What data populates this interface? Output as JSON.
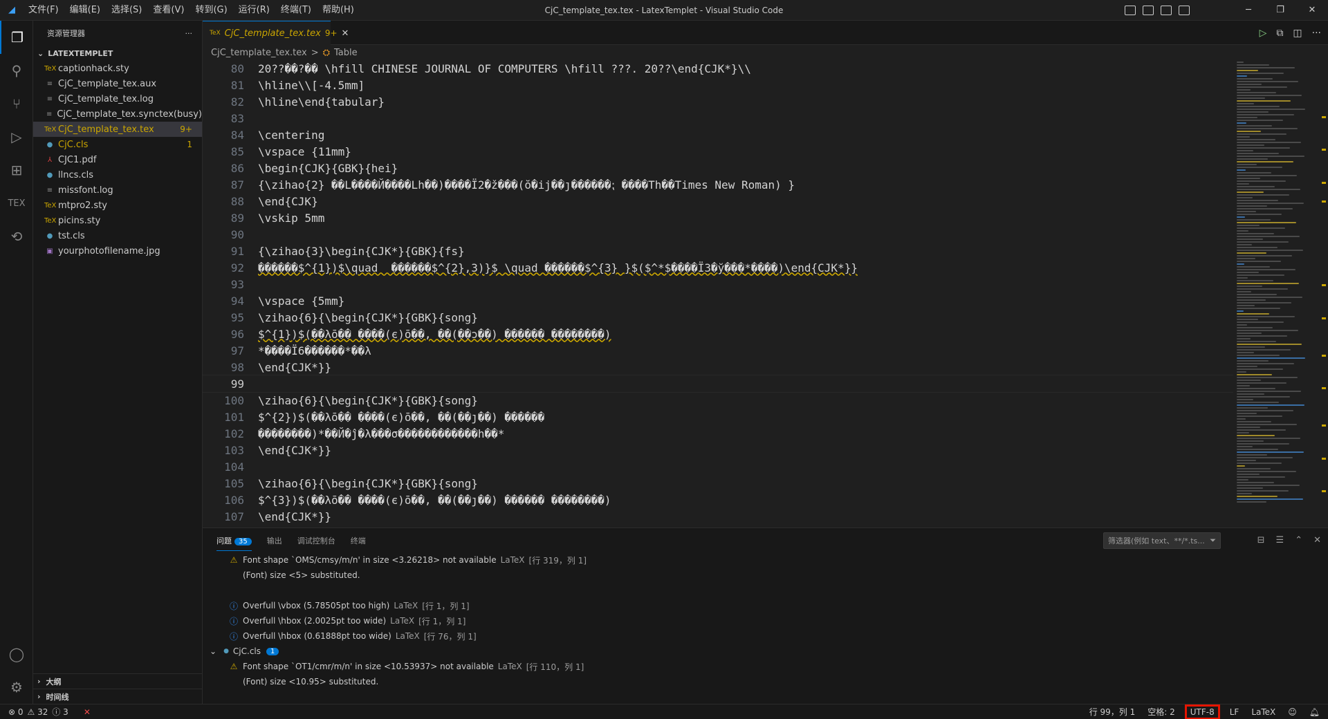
{
  "titlebar": {
    "logo": "◢",
    "menus": [
      "文件(F)",
      "编辑(E)",
      "选择(S)",
      "查看(V)",
      "转到(G)",
      "运行(R)",
      "终端(T)",
      "帮助(H)"
    ],
    "title": "CjC_template_tex.tex - LatexTemplet - Visual Studio Code",
    "minimize": "─",
    "restore": "❐",
    "close": "✕"
  },
  "sidebar": {
    "title": "资源管理器",
    "more": "···",
    "folder": "LATEXTEMPLET",
    "files": [
      {
        "name": "captionhack.sty",
        "icon": "TeX",
        "badge": ""
      },
      {
        "name": "CjC_template_tex.aux",
        "icon": "≡",
        "badge": ""
      },
      {
        "name": "CjC_template_tex.log",
        "icon": "≡",
        "badge": ""
      },
      {
        "name": "CjC_template_tex.synctex(busy)",
        "icon": "≡",
        "badge": ""
      },
      {
        "name": "CjC_template_tex.tex",
        "icon": "TeX",
        "badge": "9+"
      },
      {
        "name": "CjC.cls",
        "icon": "●",
        "badge": "1"
      },
      {
        "name": "CJC1.pdf",
        "icon": "⅄",
        "badge": ""
      },
      {
        "name": "llncs.cls",
        "icon": "●",
        "badge": ""
      },
      {
        "name": "missfont.log",
        "icon": "≡",
        "badge": ""
      },
      {
        "name": "mtpro2.sty",
        "icon": "TeX",
        "badge": ""
      },
      {
        "name": "picins.sty",
        "icon": "TeX",
        "badge": ""
      },
      {
        "name": "tst.cls",
        "icon": "●",
        "badge": ""
      },
      {
        "name": "yourphotofilename.jpg",
        "icon": "▣",
        "badge": ""
      }
    ],
    "outline": "大纲",
    "timeline": "时间线"
  },
  "editor": {
    "tab": {
      "name": "CjC_template_tex.tex",
      "count": "9+",
      "close": "✕"
    },
    "breadcrumb": {
      "file": "CjC_template_tex.tex",
      "sep": ">",
      "symbol": "Table"
    },
    "lines": [
      {
        "n": "80",
        "t": "20??��?�� \\hfill CHINESE JOURNAL OF COMPUTERS \\hfill ???. 20??\\end{CJK*}\\\\"
      },
      {
        "n": "81",
        "t": "\\hline\\\\[-4.5mm]"
      },
      {
        "n": "82",
        "t": "\\hline\\end{tabular}"
      },
      {
        "n": "83",
        "t": ""
      },
      {
        "n": "84",
        "t": "\\centering"
      },
      {
        "n": "85",
        "t": "\\vspace {11mm}"
      },
      {
        "n": "86",
        "t": "\\begin{CJK}{GBK}{hei}"
      },
      {
        "n": "87",
        "t": "{\\zihao{2} ��L����Й����Lh��)����Ї2�ž���(ŏ�ij��ȷ������⁏ ����Th��Times New Roman) }"
      },
      {
        "n": "88",
        "t": "\\end{CJK}"
      },
      {
        "n": "89",
        "t": "\\vskip 5mm"
      },
      {
        "n": "90",
        "t": ""
      },
      {
        "n": "91",
        "t": "{\\zihao{3}\\begin{CJK*}{GBK}{fs}"
      },
      {
        "n": "92",
        "t": "������$^{1})$\\quad  ������$^{2},3)}$ \\quad ������$^{3} }$($^*$����Ї3�ў���*����)\\end{CJK*}}"
      },
      {
        "n": "93",
        "t": ""
      },
      {
        "n": "94",
        "t": "\\vspace {5mm}"
      },
      {
        "n": "95",
        "t": "\\zihao{6}{\\begin{CJK*}{GBK}{song}"
      },
      {
        "n": "96",
        "t": "$^{1})$(��λō�� ����(є)ō��, ��(��ɔ��) ������ ��������)"
      },
      {
        "n": "97",
        "t": "*����Ї6������*��λ"
      },
      {
        "n": "98",
        "t": "\\end{CJK*}}"
      },
      {
        "n": "99",
        "t": ""
      },
      {
        "n": "100",
        "t": "\\zihao{6}{\\begin{CJK*}{GBK}{song}"
      },
      {
        "n": "101",
        "t": "$^{2})$(��λō�� ����(є)ō��, ��(��ȷ��) ������"
      },
      {
        "n": "102",
        "t": "��������)*��Й�ĵ�λ���σ������������h��*"
      },
      {
        "n": "103",
        "t": "\\end{CJK*}}"
      },
      {
        "n": "104",
        "t": ""
      },
      {
        "n": "105",
        "t": "\\zihao{6}{\\begin{CJK*}{GBK}{song}"
      },
      {
        "n": "106",
        "t": "$^{3})$(��λō�� ����(є)ō��, ��(��ȷ��) ������ ��������)"
      },
      {
        "n": "107",
        "t": "\\end{CJK*}}"
      }
    ]
  },
  "panel": {
    "tabs": [
      {
        "label": "问题",
        "count": "35"
      },
      {
        "label": "输出"
      },
      {
        "label": "调试控制台"
      },
      {
        "label": "终端"
      }
    ],
    "filter_placeholder": "筛选器(例如 text、**/*.ts...",
    "rows": [
      {
        "kind": "warn",
        "msg": "Font shape `OMS/cmsy/m/n' in size <3.26218> not available",
        "src": "LaTeX",
        "loc": "[行 319，列 1]",
        "indent": 36
      },
      {
        "kind": "text",
        "msg": "(Font) size <5> substituted.",
        "indent": 58
      },
      {
        "kind": "blank",
        "msg": "",
        "indent": 0
      },
      {
        "kind": "info",
        "msg": "Overfull \\vbox (5.78505pt too high)",
        "src": "LaTeX",
        "loc": "[行 1，列 1]",
        "indent": 36
      },
      {
        "kind": "info",
        "msg": "Overfull \\hbox (2.0025pt too wide)",
        "src": "LaTeX",
        "loc": "[行 1，列 1]",
        "indent": 36
      },
      {
        "kind": "info",
        "msg": "Overfull \\hbox (0.61888pt too wide)",
        "src": "LaTeX",
        "loc": "[行 76，列 1]",
        "indent": 36
      },
      {
        "kind": "group",
        "msg": "CjC.cls",
        "count": "1",
        "indent": 10
      },
      {
        "kind": "warn",
        "msg": "Font shape `OT1/cmr/m/n' in size <10.53937> not available",
        "src": "LaTeX",
        "loc": "[行 110，列 1]",
        "indent": 36
      },
      {
        "kind": "text",
        "msg": "(Font) size <10.95> substituted.",
        "indent": 58
      }
    ]
  },
  "status": {
    "errors": "⊗ 0",
    "warnings": "⚠ 32",
    "infos": "ⓘ 3",
    "x": "✕",
    "position": "行 99，列 1",
    "spaces": "空格: 2",
    "encoding": "UTF-8",
    "eol": "LF",
    "language": "LaTeX"
  }
}
